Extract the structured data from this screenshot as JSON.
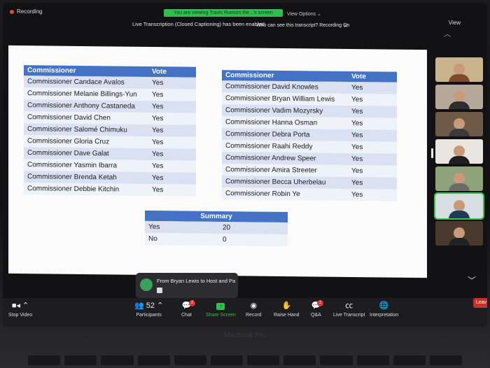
{
  "topbar": {
    "recording": "Recording",
    "viewing_banner": "You are viewing Travis Rumors the...'s screen",
    "view_options": "View Options ⌄",
    "transcript_notice": "Live Transcription (Closed Captioning) has been enabled",
    "who_can_see": "Who can see this transcript? Recording On",
    "close": "×",
    "view": "View"
  },
  "left_table": {
    "headers": [
      "Commissioner",
      "Vote"
    ],
    "rows": [
      {
        "name": "Commissioner Candace Avalos",
        "vote": "Yes"
      },
      {
        "name": "Commissioner Melanie Billings-Yun",
        "vote": "Yes"
      },
      {
        "name": "Commissioner Anthony Castaneda",
        "vote": "Yes"
      },
      {
        "name": "Commissioner David Chen",
        "vote": "Yes"
      },
      {
        "name": "Commissioner Salomé Chimuku",
        "vote": "Yes"
      },
      {
        "name": "Commissioner Gloria Cruz",
        "vote": "Yes"
      },
      {
        "name": "Commissioner Dave Galat",
        "vote": "Yes"
      },
      {
        "name": "Commissioner Yasmin Ibarra",
        "vote": "Yes"
      },
      {
        "name": "Commissioner Brenda Ketah",
        "vote": "Yes"
      },
      {
        "name": "Commissioner Debbie Kitchin",
        "vote": "Yes"
      }
    ]
  },
  "right_table": {
    "headers": [
      "Commissioner",
      "Vote"
    ],
    "rows": [
      {
        "name": "Commissioner David Knowles",
        "vote": "Yes"
      },
      {
        "name": "Commissioner Bryan William Lewis",
        "vote": "Yes"
      },
      {
        "name": "Commissioner Vadim Mozyrsky",
        "vote": "Yes"
      },
      {
        "name": "Commissioner Hanna Osman",
        "vote": "Yes"
      },
      {
        "name": "Commissioner Debra Porta",
        "vote": "Yes"
      },
      {
        "name": "Commissioner Raahi Reddy",
        "vote": "Yes"
      },
      {
        "name": "Commissioner Andrew Speer",
        "vote": "Yes"
      },
      {
        "name": "Commissioner Amira Streeter",
        "vote": "Yes"
      },
      {
        "name": "Commissioner Becca Uherbelau",
        "vote": "Yes"
      },
      {
        "name": "Commissioner Robin Ye",
        "vote": "Yes"
      }
    ]
  },
  "summary_table": {
    "header": "Summary",
    "rows": [
      {
        "label": "Yes",
        "value": "20"
      },
      {
        "label": "No",
        "value": "0"
      }
    ]
  },
  "video_tiles": [
    {
      "bg": "#c9b48e",
      "shirt": "#7a4b2e"
    },
    {
      "bg": "#b7a99a",
      "shirt": "#2d2d2d"
    },
    {
      "bg": "#6f5a48",
      "shirt": "#3a3a3a"
    },
    {
      "bg": "#e9e6e2",
      "shirt": "#1f1f1f"
    },
    {
      "bg": "#8fa37a",
      "shirt": "#6b6b6b"
    },
    {
      "bg": "#d7dde0",
      "shirt": "#1f3a5a"
    },
    {
      "bg": "#4a3a2e",
      "shirt": "#222222"
    }
  ],
  "toast": {
    "message": "From Bryan Lewis to Host and Pan..."
  },
  "toolbar": {
    "stop_video": "Stop Video",
    "participants_count": "52",
    "participants": "Participants",
    "chat": "Chat",
    "chat_badge": "2",
    "share_screen": "Share Screen",
    "record": "Record",
    "raise_hand": "Raise Hand",
    "qa": "Q&A",
    "qa_badge": "2",
    "live_transcript": "Live Transcript",
    "interpretation": "Interpretation",
    "leave": "Leav"
  },
  "brand": "MacBook Pro",
  "colors": {
    "table_header": "#4472c4",
    "row_alt": "#d9e1f2",
    "share_green": "#2fbf4a",
    "leave_red": "#c9302c"
  }
}
